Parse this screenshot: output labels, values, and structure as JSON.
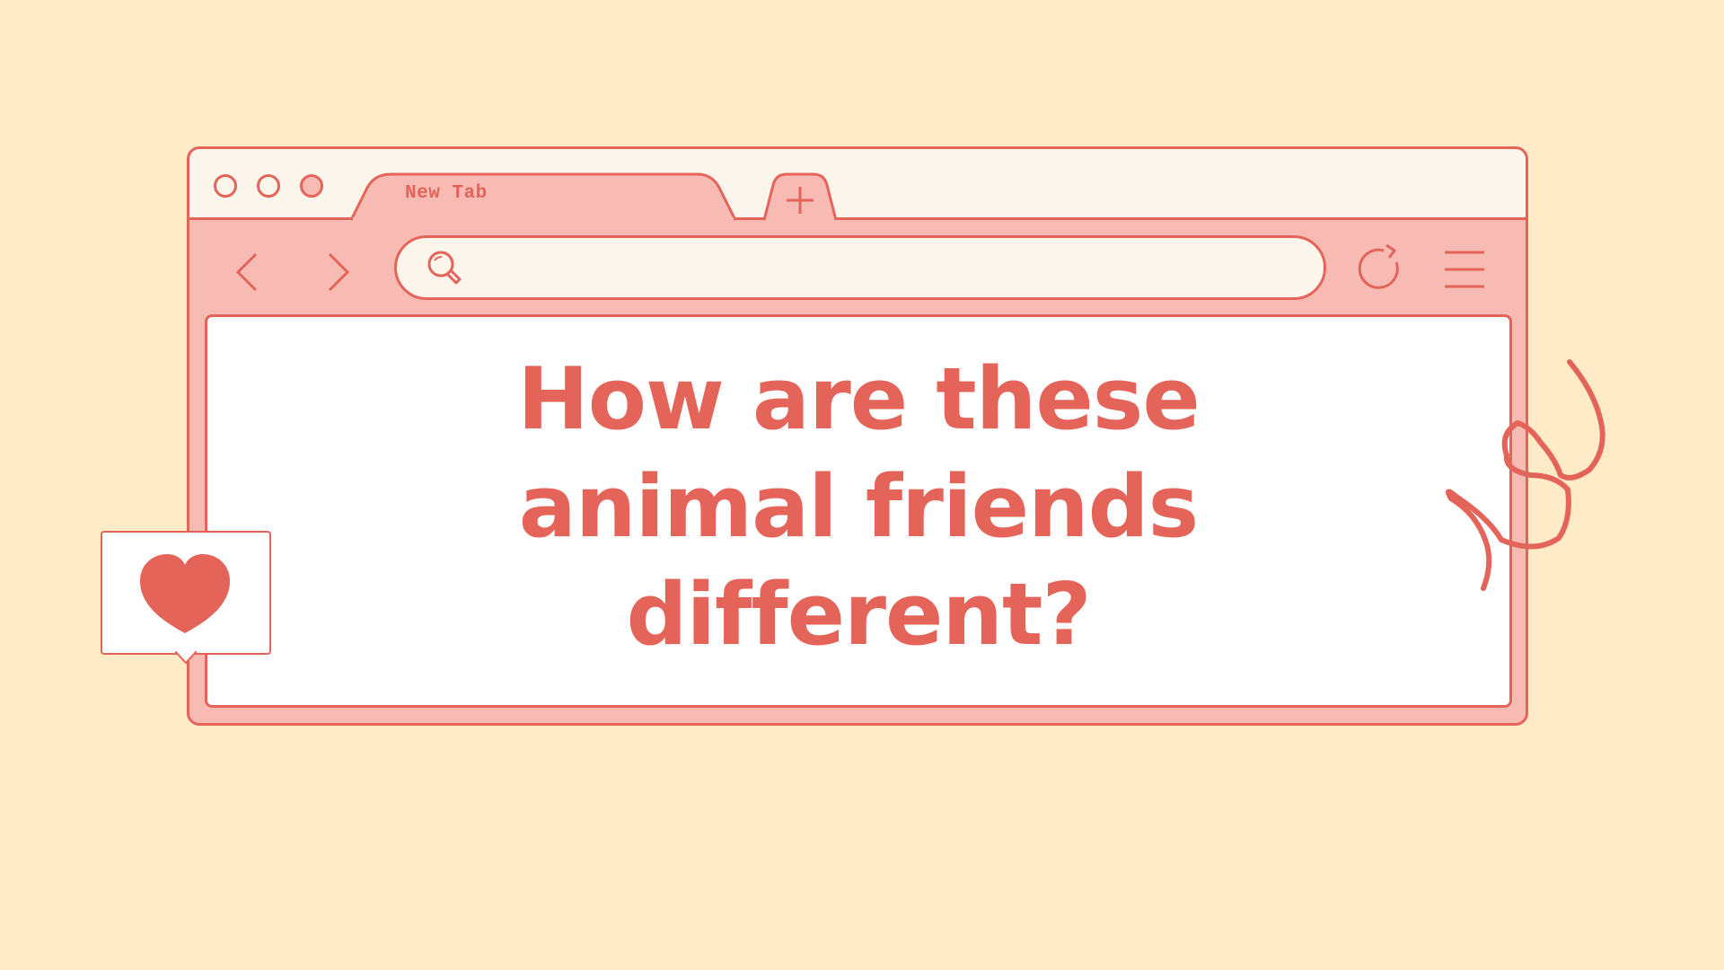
{
  "page": {
    "background_color": "#FFEBC8",
    "accent_color": "#E5645A",
    "frame_color": "#F7BBB4"
  },
  "browser": {
    "window_controls": [
      "window-dot",
      "window-dot",
      "window-dot"
    ],
    "tab": {
      "label": "New Tab"
    },
    "new_tab_button": {
      "icon": "plus-icon"
    },
    "toolbar": {
      "back_icon": "chevron-left-icon",
      "forward_icon": "chevron-right-icon",
      "search_icon": "search-icon",
      "reload_icon": "reload-icon",
      "menu_icon": "hamburger-menu-icon"
    },
    "address_bar": {
      "value": "",
      "placeholder": ""
    }
  },
  "content": {
    "headline_lines": [
      "How are these",
      "animal friends",
      "different?"
    ]
  },
  "decorations": {
    "like_bubble_icon": "heart-icon",
    "squiggle": "doodle-loop"
  }
}
